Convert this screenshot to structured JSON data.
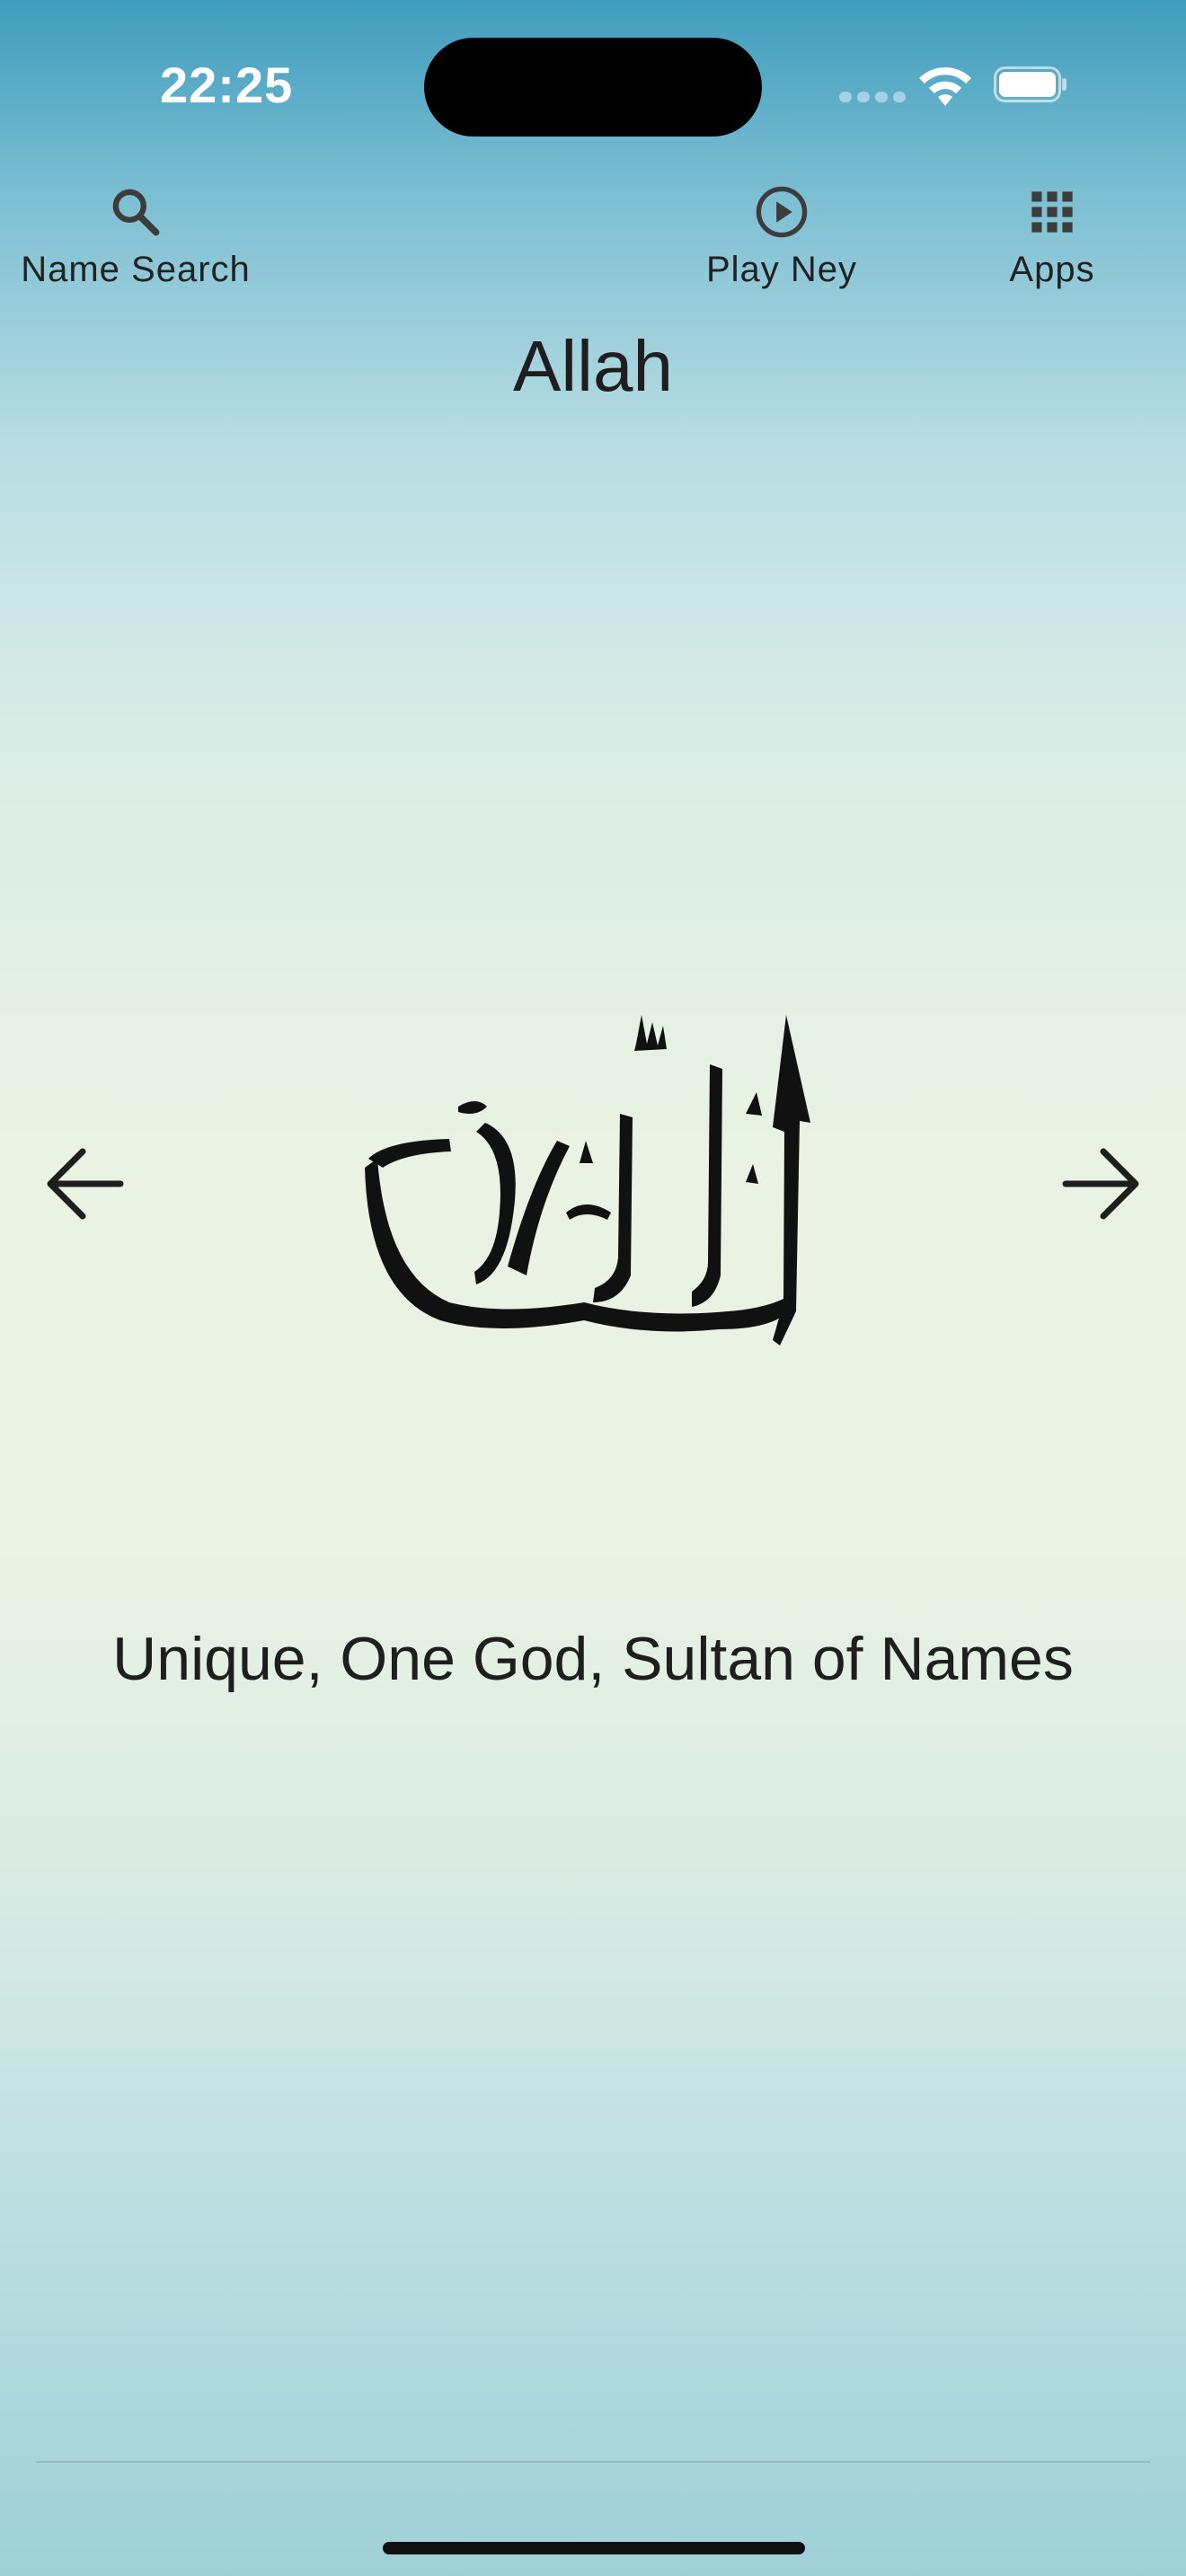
{
  "status_bar": {
    "time": "22:25",
    "icons": [
      "cellular-signal-icon",
      "wifi-icon",
      "battery-icon"
    ]
  },
  "toolbar": {
    "search_label": "Name Search",
    "search_icon": "search-icon",
    "play_label": "Play Ney",
    "play_icon": "play-circle-icon",
    "apps_label": "Apps",
    "apps_icon": "grid-icon"
  },
  "page": {
    "title": "Allah",
    "calligraphy_icon": "allah-calligraphy",
    "prev_icon": "arrow-left-icon",
    "next_icon": "arrow-right-icon",
    "meaning": "Unique, One God, Sultan of Names"
  },
  "colors": {
    "gradient_top": "#3f9dbd",
    "gradient_middle": "#eaf3e3",
    "gradient_bottom": "#9fd0d8",
    "icon": "#3c3c3c",
    "text": "#1e1e1e"
  }
}
